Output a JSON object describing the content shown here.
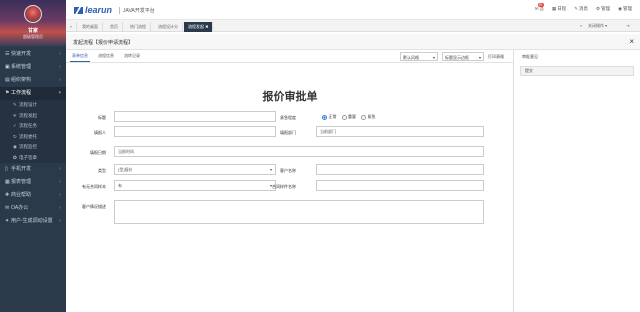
{
  "user": {
    "name": "甘家",
    "role": "超级管理员"
  },
  "sidebar": {
    "items": [
      {
        "label": "快速开发",
        "icon": "☰"
      },
      {
        "label": "系统管理",
        "icon": "▣"
      },
      {
        "label": "组织架构",
        "icon": "▤"
      },
      {
        "label": "工作流程",
        "icon": "⚑"
      }
    ],
    "subitems": [
      {
        "label": "流程设计",
        "icon": "✎"
      },
      {
        "label": "流程发起",
        "icon": "✈"
      },
      {
        "label": "流程任务",
        "icon": "✓"
      },
      {
        "label": "流程委托",
        "icon": "↻"
      },
      {
        "label": "流程监控",
        "icon": "◉"
      },
      {
        "label": "电子签章",
        "icon": "✪"
      }
    ],
    "items2": [
      {
        "label": "手机开发",
        "icon": "▯"
      },
      {
        "label": "报表管理",
        "icon": "▦"
      },
      {
        "label": "商业帮助",
        "icon": "✚"
      },
      {
        "label": "OA办公",
        "icon": "✉"
      },
      {
        "label": "用户-生成调动设置",
        "icon": "✦"
      }
    ]
  },
  "topbar": {
    "logo": "learun",
    "subtitle": "JAVA开发平台",
    "nav": [
      {
        "label": "吾",
        "icon": "✉",
        "badge": "9+"
      },
      {
        "label": "日程",
        "icon": "▦"
      },
      {
        "label": "消息",
        "icon": "✎"
      },
      {
        "label": "管理",
        "icon": "⚙"
      },
      {
        "label": "管理",
        "icon": "◉"
      }
    ]
  },
  "tabs": {
    "left_icon": "«",
    "items": [
      "我的桌面",
      "首页",
      "热门流程",
      "流程设计分",
      "流程发起"
    ],
    "active_index": 4,
    "close_icon": "✖",
    "right_icon": "»",
    "right_op": "关闭操作 ▾",
    "right_end": "⇥"
  },
  "panel": {
    "title": "发起流程【报价申请流程】",
    "close": "×"
  },
  "inner_tabs": [
    "表单信息",
    "流程信息",
    "流转记录"
  ],
  "toolbar": {
    "wind_style": "默认风格",
    "mode": "标题显示边框",
    "print": "打印表格"
  },
  "form": {
    "title": "报价审批单",
    "labels": {
      "title": "标题",
      "urgency": "紧急程度",
      "applicant": "填报人",
      "dept": "填报部门",
      "date": "填报日期",
      "type": "类型",
      "customer": "客户名称",
      "draft": "有无合同样本",
      "contract_no": "合同样件名称",
      "notes": "客户情况描述"
    },
    "urgency_options": [
      "正常",
      "重要",
      "紧急"
    ],
    "urgency_selected": 0,
    "dept_placeholder": "当前部门",
    "date_placeholder": "当前时间",
    "type_value": "(型)报价",
    "draft_value": "有"
  },
  "side": {
    "header": "审批意见",
    "button": "提交"
  }
}
